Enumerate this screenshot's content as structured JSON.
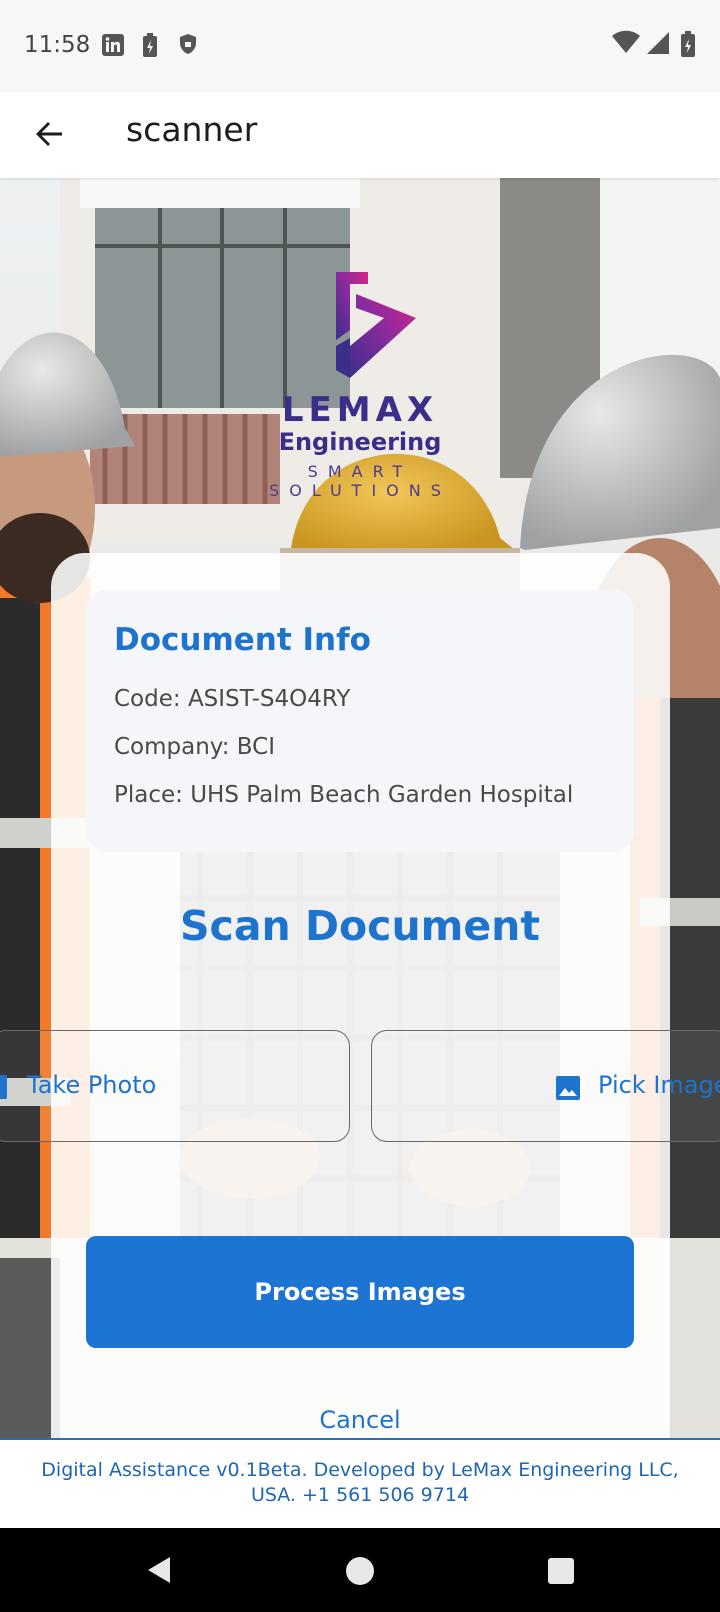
{
  "status_bar": {
    "time": "11:58",
    "left_icons": [
      "linkedin-icon",
      "battery-saver-icon",
      "shield-icon"
    ],
    "right_icons": [
      "wifi-icon",
      "signal-icon",
      "battery-icon"
    ]
  },
  "app_bar": {
    "back_icon": "arrow-back-icon",
    "title": "scanner"
  },
  "logo": {
    "name": "LEMAX",
    "line2": "Engineering",
    "tagline": "SMART SOLUTIONS"
  },
  "document_info": {
    "title": "Document Info",
    "code": "Code: ASIST-S4O4RY",
    "company": "Company: BCI",
    "place": "Place: UHS Palm Beach Garden Hospital"
  },
  "scan": {
    "title": "Scan Document",
    "take_photo_label": "Take Photo",
    "take_photo_icon": "camera-icon",
    "pick_image_label": "Pick Image",
    "pick_image_icon": "image-icon"
  },
  "actions": {
    "process_label": "Process Images",
    "cancel_label": "Cancel"
  },
  "footer": {
    "line1": "Digital Assistance v0.1Beta. Developed by LeMax Engineering LLC,",
    "line2": "USA. +1 561 506 9714"
  },
  "nav_bar": {
    "icons": [
      "nav-back-icon",
      "nav-home-icon",
      "nav-recents-icon"
    ]
  },
  "colors": {
    "accent": "#1E74CC",
    "button": "#1C74D3",
    "logo_purple": "#3A2E8A",
    "logo_magenta": "#D8238A"
  }
}
